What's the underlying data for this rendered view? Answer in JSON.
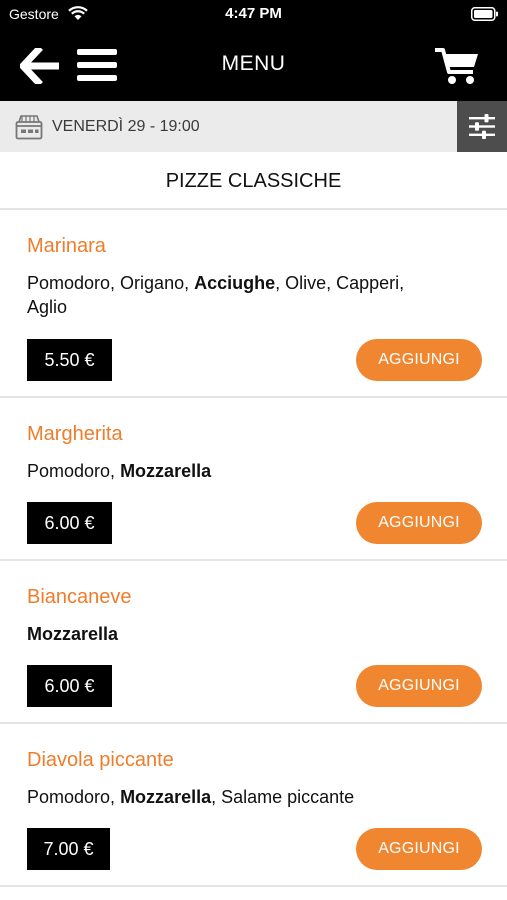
{
  "status_bar": {
    "carrier": "Gestore",
    "time": "4:47 PM"
  },
  "nav": {
    "title": "MENU"
  },
  "date_bar": {
    "text": "VENERDÌ 29 - 19:00"
  },
  "section": {
    "title": "PIZZE CLASSICHE"
  },
  "add_label": "AGGIUNGI",
  "colors": {
    "accent": "#f08630",
    "title_orange": "#ee7d2b",
    "bar": "#000000",
    "strip": "#ebebeb"
  },
  "products": [
    {
      "name": "Marinara",
      "desc_line1": {
        "pre": "Pomodoro, Origano, ",
        "bold": "Acciughe",
        "post": ", Olive, Capperi,"
      },
      "desc_line2": "Aglio",
      "price": "5.50 €"
    },
    {
      "name": "Margherita",
      "desc": {
        "pre": "Pomodoro, ",
        "bold": "Mozzarella",
        "post": ""
      },
      "price": "6.00 €"
    },
    {
      "name": "Biancaneve",
      "desc": {
        "pre": "",
        "bold": "Mozzarella",
        "post": ""
      },
      "price": "6.00 €"
    },
    {
      "name": "Diavola piccante",
      "desc": {
        "pre": "Pomodoro, ",
        "bold": "Mozzarella",
        "post": ", Salame piccante"
      },
      "price": "7.00 €"
    }
  ]
}
